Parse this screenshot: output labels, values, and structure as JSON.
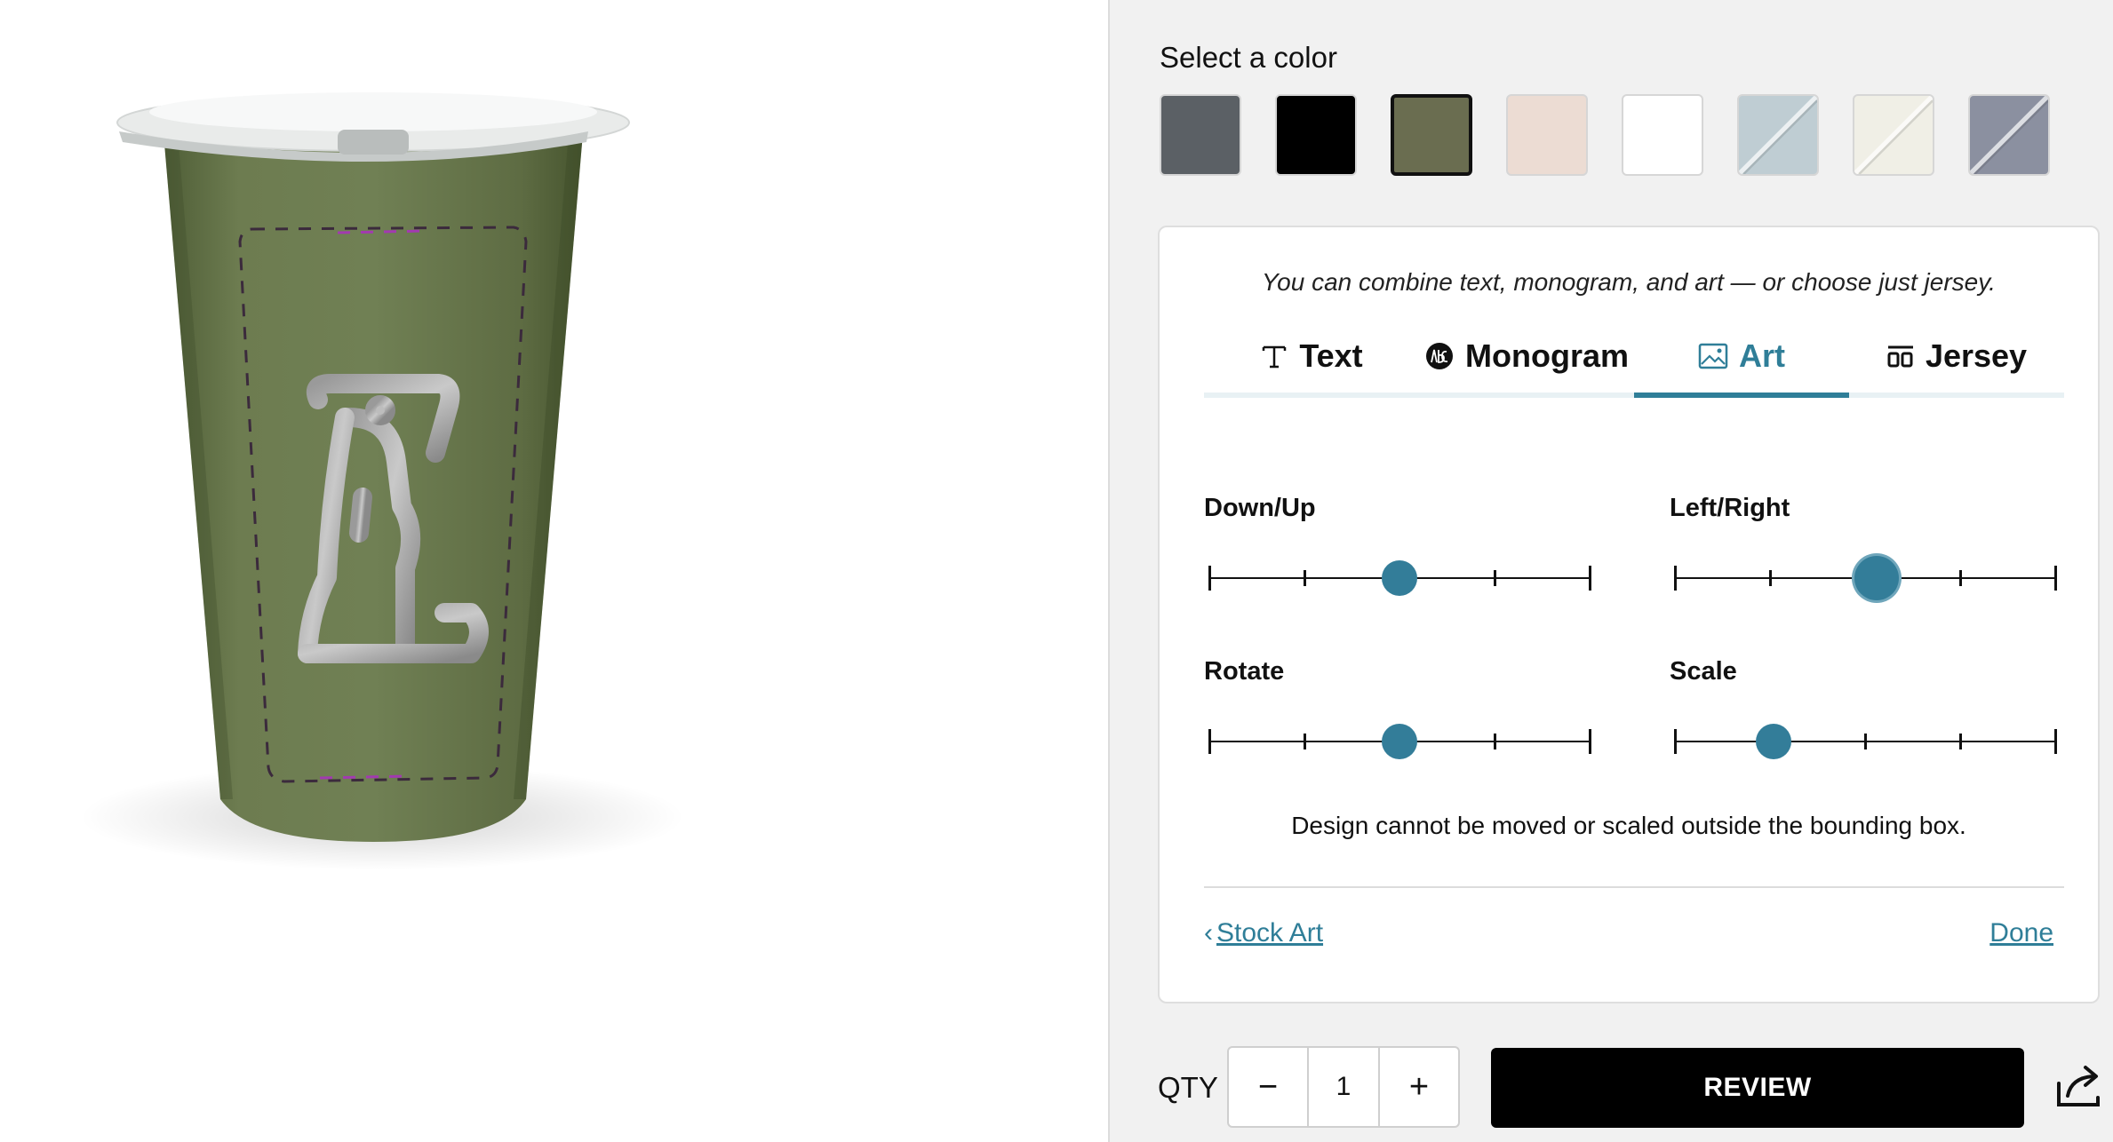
{
  "product_viewer": {
    "product": "tumbler",
    "engraving_art": "dog-art"
  },
  "color_picker": {
    "label": "Select a color",
    "swatches": [
      {
        "name": "gray",
        "color": "#5b6065",
        "selected": false
      },
      {
        "name": "black",
        "color": "#000000",
        "selected": false
      },
      {
        "name": "olive",
        "color": "#6a6d50",
        "selected": true
      },
      {
        "name": "blush",
        "color": "#ecdcd3",
        "selected": false
      },
      {
        "name": "white",
        "color": "#ffffff",
        "selected": false
      },
      {
        "name": "powder-blue",
        "color": "#bfcdd3",
        "selected": false
      },
      {
        "name": "cream",
        "color": "#f0efe6",
        "selected": false
      },
      {
        "name": "slate",
        "color": "#8b90a0",
        "selected": false
      }
    ]
  },
  "customizer": {
    "hint": "You can combine text, monogram, and art — or choose just jersey.",
    "tabs": [
      {
        "label": "Text",
        "icon": "text-icon",
        "active": false
      },
      {
        "label": "Monogram",
        "icon": "monogram-icon",
        "active": false
      },
      {
        "label": "Art",
        "icon": "image-icon",
        "active": true
      },
      {
        "label": "Jersey",
        "icon": "jersey-icon",
        "active": false
      }
    ],
    "sliders": [
      {
        "label": "Down/Up",
        "value": 0.5,
        "focused": false
      },
      {
        "label": "Left/Right",
        "value": 0.53,
        "focused": true
      },
      {
        "label": "Rotate",
        "value": 0.5,
        "focused": false
      },
      {
        "label": "Scale",
        "value": 0.26,
        "focused": false
      }
    ],
    "notice": "Design cannot be moved or scaled outside the bounding box.",
    "back_link": "Stock Art",
    "done_link": "Done"
  },
  "purchase": {
    "qty_label": "QTY",
    "minus": "−",
    "qty": "1",
    "plus": "+",
    "review_label": "REVIEW"
  },
  "colors": {
    "accent": "#2f7e98",
    "slider_thumb": "#337d99",
    "tumbler": "#6b7a50"
  }
}
